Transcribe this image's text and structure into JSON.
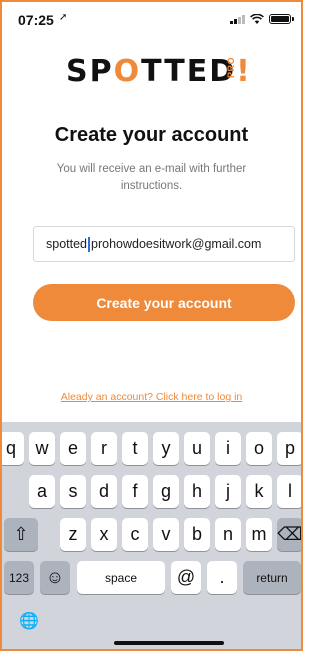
{
  "status": {
    "time": "07:25",
    "location_glyph": "➚"
  },
  "logo": {
    "part1": "SP",
    "o": "O",
    "part2": "TTED",
    "bang": "!",
    "pro": "PRO"
  },
  "title": "Create your account",
  "subtitle": "You will receive an e-mail with further instructions.",
  "email": {
    "before_caret": "spotted",
    "after_caret": "prohowdoesitwork@gmail.com"
  },
  "cta_label": "Create your account",
  "login_link": "Aleady an account? Click here to log in",
  "keyboard": {
    "row1": [
      "q",
      "w",
      "e",
      "r",
      "t",
      "y",
      "u",
      "i",
      "o",
      "p"
    ],
    "row2": [
      "a",
      "s",
      "d",
      "f",
      "g",
      "h",
      "j",
      "k",
      "l"
    ],
    "row3": [
      "z",
      "x",
      "c",
      "v",
      "b",
      "n",
      "m"
    ],
    "shift": "⇧",
    "backspace": "⌫",
    "numbers": "123",
    "emoji": "☺",
    "space": "space",
    "at": "@",
    "dot": ".",
    "return": "return",
    "globe": "🌐"
  },
  "colors": {
    "accent": "#ef8a3a",
    "keyboard_bg": "#d1d4da"
  }
}
